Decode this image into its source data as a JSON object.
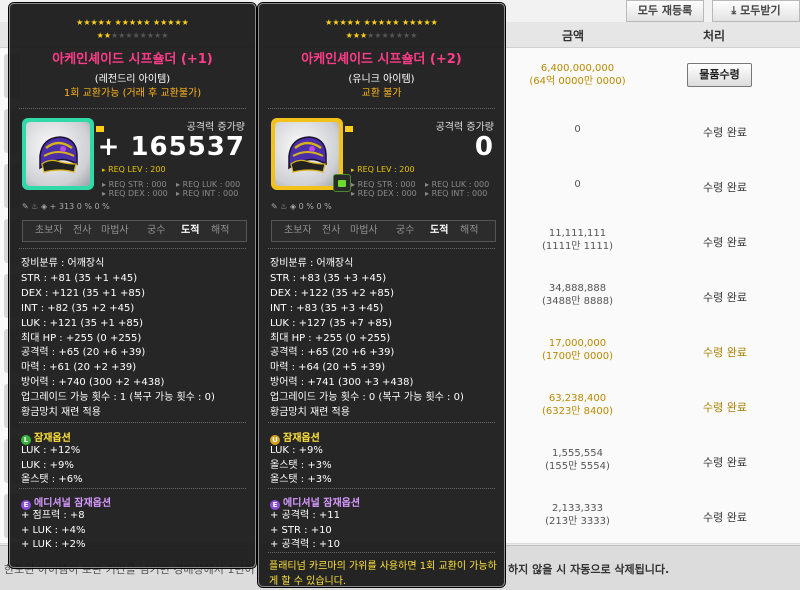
{
  "page": {
    "topbar": {
      "btn_left": "모두 재등록",
      "btn_right": "모두받기"
    },
    "columns": {
      "amount": "금액",
      "process": "처리"
    },
    "rows": [
      {
        "amount": "6,400,000,000",
        "sub": "(64억 0000만 0000)",
        "gold": true,
        "status": "물품수령",
        "button": true
      },
      {
        "amount": "0",
        "sub": "",
        "gold": false,
        "status": "수령 완료",
        "button": false
      },
      {
        "amount": "0",
        "sub": "",
        "gold": false,
        "status": "수령 완료",
        "button": false
      },
      {
        "amount": "11,111,111",
        "sub": "(1111만 1111)",
        "gold": false,
        "status": "수령 완료",
        "button": false
      },
      {
        "amount": "34,888,888",
        "sub": "(3488만 8888)",
        "gold": false,
        "status": "수령 완료",
        "button": false
      },
      {
        "amount": "17,000,000",
        "sub": "(1700만 0000)",
        "gold": true,
        "status": "수령 완료",
        "button": false
      },
      {
        "amount": "63,238,400",
        "sub": "(6323만 8400)",
        "gold": true,
        "status": "수령 완료",
        "button": false
      },
      {
        "amount": "1,555,554",
        "sub": "(155만 5554)",
        "gold": false,
        "status": "수령 완료",
        "button": false
      },
      {
        "amount": "2,133,333",
        "sub": "(213만 3333)",
        "gold": false,
        "status": "수령 완료",
        "button": false
      }
    ],
    "footer": {
      "left_text": "한도된 아이템이 보관 기간을 넘기면 경매장에서 1년이",
      "right_text": "하지 않을 시 자동으로 삭제됩니다."
    }
  },
  "tooltips": [
    {
      "stars_on": "★★★★★ ★★★★★ ★★★★★",
      "stars_row2_on": "★★",
      "stars_row2_off": "★★★★★★★★",
      "name": "아케인셰이드 시프숄더 (+1)",
      "grade": "(레전드리 아이템)",
      "trade": "1회 교환가능 (거래 후 교환불가)",
      "cp_label": "공격력 증가량",
      "cp_value": "+ 165537",
      "req_lev": "REQ LEV : 200",
      "req_str": "REQ STR : 000",
      "req_dex": "REQ DEX : 000",
      "req_luk": "REQ LUK : 000",
      "req_int": "REQ INT : 000",
      "mini": "+ 313    0 %    0 %",
      "jobs": [
        "초보자",
        "전사",
        "마법사",
        "궁수",
        "도적",
        "해적"
      ],
      "stats": [
        "장비분류 : 어깨장식",
        "STR : +81 (35 +1 +45)",
        "DEX : +121 (35 +1 +85)",
        "INT : +82 (35 +2 +45)",
        "LUK : +121 (35 +1 +85)",
        "최대 HP : +255 (0 +255)",
        "공격력 : +65 (20 +6 +39)",
        "마력 : +61 (20 +2 +39)",
        "방어력 : +740 (300 +2 +438)",
        "업그레이드 가능 횟수 : 1 (복구 가능 횟수 : 0)",
        "황금망치 재련 적용"
      ],
      "pot_title": "잠재옵션",
      "pot_badge": "L",
      "pot": [
        "LUK : +12%",
        "LUK : +9%",
        "올스탯 : +6%"
      ],
      "add_title": "에디셔널 잠재옵션",
      "add_badge": "E",
      "add": [
        "+ 점프력 : +8",
        "+ LUK : +4%",
        "+ LUK : +2%"
      ],
      "footnote": ""
    },
    {
      "stars_on": "★★★★★ ★★★★★ ★★★★★",
      "stars_row2_on": "★★★",
      "stars_row2_off": "★★★★★★★",
      "name": "아케인셰이드 시프숄더 (+2)",
      "grade": "(유니크 아이템)",
      "trade": "교환 불가",
      "cp_label": "공격력 증가량",
      "cp_value": "0",
      "req_lev": "REQ LEV : 200",
      "req_str": "REQ STR : 000",
      "req_dex": "REQ DEX : 000",
      "req_luk": "REQ LUK : 000",
      "req_int": "REQ INT : 000",
      "mini": "0 %    0 %",
      "jobs": [
        "초보자",
        "전사",
        "마법사",
        "궁수",
        "도적",
        "해적"
      ],
      "stats": [
        "장비분류 : 어깨장식",
        "STR : +83 (35 +3 +45)",
        "DEX : +122 (35 +2 +85)",
        "INT : +83 (35 +3 +45)",
        "LUK : +127 (35 +7 +85)",
        "최대 HP : +255 (0 +255)",
        "공격력 : +65 (20 +6 +39)",
        "마력 : +64 (20 +5 +39)",
        "방어력 : +741 (300 +3 +438)",
        "업그레이드 가능 횟수 : 0 (복구 가능 횟수 : 0)",
        "황금망치 재련 적용"
      ],
      "pot_title": "잠재옵션",
      "pot_badge": "U",
      "pot": [
        "LUK : +9%",
        "올스탯 : +3%",
        "올스탯 : +3%"
      ],
      "add_title": "에디셔널 잠재옵션",
      "add_badge": "E",
      "add": [
        "+ 공격력 : +11",
        "+ STR : +10",
        "+ 공격력 : +10"
      ],
      "footnote": "플래티넘 카르마의 가위를 사용하면 1회 교환이 가능하게 할 수 있습니다."
    }
  ],
  "colors": {
    "name": "#ff3c8a",
    "legendary_frame": "#32d9a8",
    "unique_frame": "#f2c21a",
    "gold": "#ffd21a"
  }
}
